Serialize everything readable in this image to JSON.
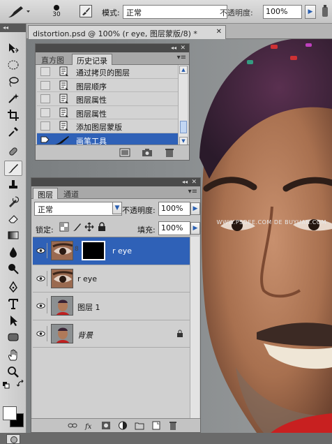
{
  "options_bar": {
    "brush_size": "30",
    "mode_label": "模式:",
    "mode_value": "正常",
    "opacity_label": "不透明度:",
    "opacity_value": "100%",
    "arrow": "▶"
  },
  "tools": {
    "collapse_label": "◂◂",
    "items": [
      "move-tool",
      "marquee-tool",
      "lasso-tool",
      "magic-wand-tool",
      "crop-tool",
      "eyedropper-tool",
      "healing-brush-tool",
      "brush-tool",
      "clone-stamp-tool",
      "history-brush-tool",
      "eraser-tool",
      "gradient-tool",
      "blur-tool",
      "dodge-tool",
      "pen-tool",
      "type-tool",
      "path-selection-tool",
      "shape-tool",
      "hand-tool",
      "zoom-tool"
    ],
    "active": "brush-tool",
    "foreground_color": "#ffffff",
    "background_color": "#000000"
  },
  "document": {
    "tab_title": "distortion.psd @ 100% (r eye, 图层蒙版/8) *",
    "close_glyph": "✕",
    "watermark": "WWW.PSDEE.COM  DE BUYUAN.COM"
  },
  "history_panel": {
    "tabs": [
      "直方图",
      "历史记录"
    ],
    "active_tab": "历史记录",
    "collapse_glyph": "◂◂",
    "close_glyph": "✕",
    "menu_glyph": "▾≡",
    "items": [
      {
        "label": "通过拷贝的图层",
        "selected": false
      },
      {
        "label": "图层顺序",
        "selected": false
      },
      {
        "label": "图层属性",
        "selected": false
      },
      {
        "label": "图层属性",
        "selected": false
      },
      {
        "label": "添加图层蒙版",
        "selected": false
      },
      {
        "label": "画笔工具",
        "selected": true
      }
    ],
    "scroll_up": "▲",
    "scroll_down": "▼"
  },
  "layers_panel": {
    "tabs": [
      "图层",
      "通道"
    ],
    "active_tab": "图层",
    "menu_glyph": "▾≡",
    "blend_mode": "正常",
    "dropdown_glyph": "▼",
    "opacity_label": "不透明度:",
    "opacity_value": "100%",
    "lock_label": "锁定:",
    "fill_label": "填充:",
    "fill_value": "100%",
    "arrow": "▶",
    "chain_glyph": "8",
    "layers": [
      {
        "name": "r eye",
        "visible": true,
        "selected": true,
        "has_mask": true,
        "locked": false,
        "thumb": "eye"
      },
      {
        "name": "r eye",
        "visible": true,
        "selected": false,
        "has_mask": false,
        "locked": false,
        "thumb": "eye"
      },
      {
        "name": "图层 1",
        "visible": true,
        "selected": false,
        "has_mask": false,
        "locked": false,
        "thumb": "portrait"
      },
      {
        "name": "背景",
        "visible": true,
        "selected": false,
        "has_mask": false,
        "locked": true,
        "thumb": "portrait"
      }
    ]
  },
  "colors": {
    "selection_blue": "#2f61b7",
    "panel_gray": "#c9c9c9"
  }
}
